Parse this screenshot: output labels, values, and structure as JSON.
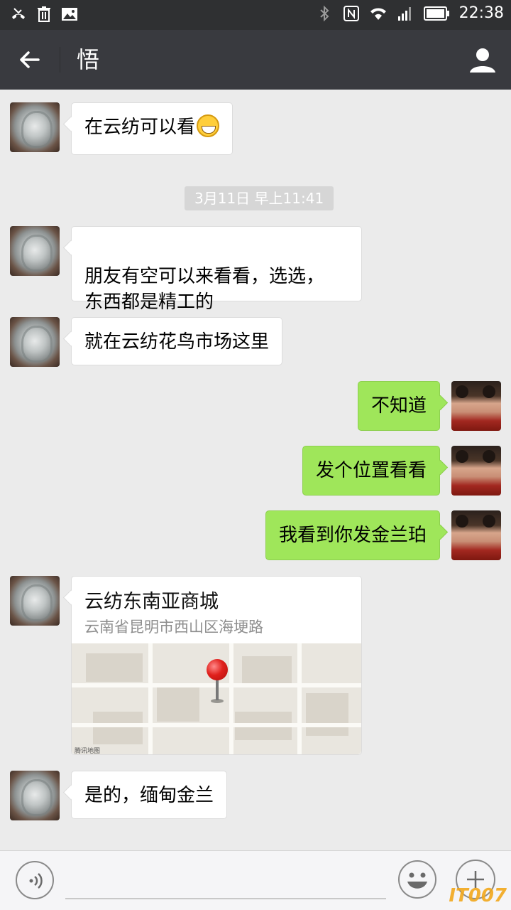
{
  "status_bar": {
    "time": "22:38"
  },
  "nav": {
    "title": "悟"
  },
  "messages": [
    {
      "text": "在云纺可以看"
    },
    {
      "text": "朋友有空可以来看看，选选，\n东西都是精工的"
    },
    {
      "text": "就在云纺花鸟市场这里"
    },
    {
      "text": "不知道"
    },
    {
      "text": "发个位置看看"
    },
    {
      "text": "我看到你发金兰珀"
    },
    {
      "text": "是的，缅甸金兰"
    }
  ],
  "timestamp": "3月11日 早上11:41",
  "location": {
    "title": "云纺东南亚商城",
    "address": "云南省昆明市西山区海埂路",
    "map_provider": "腾讯地图"
  },
  "watermark": "IT007",
  "colors": {
    "out_bubble": "#9fe65a",
    "nav_bg": "#393a3f",
    "chat_bg": "#ebebeb"
  }
}
